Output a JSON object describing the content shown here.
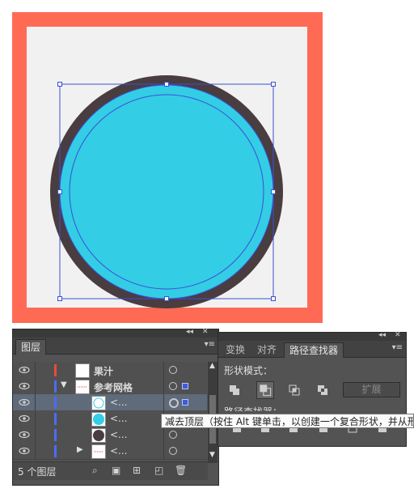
{
  "layers_panel": {
    "collapse_icon": "double-chevron-left-icon",
    "close_icon": "close-icon",
    "tab_label": "图层",
    "menu_icon": "panel-menu-icon",
    "rows": [
      {
        "name": "果汁",
        "color": "#e84c3d"
      },
      {
        "name": "参考网格",
        "color": "#4a6cf7"
      },
      {
        "name": "<...",
        "color": "#4a6cf7"
      },
      {
        "name": "<...",
        "color": "#4a6cf7"
      },
      {
        "name": "<...",
        "color": "#4a6cf7"
      },
      {
        "name": "<...",
        "color": "#4a6cf7"
      }
    ],
    "footer_label": "5 个图层"
  },
  "pathfinder_panel": {
    "tabs": [
      "变换",
      "对齐",
      "路径查找器"
    ],
    "active_tab": "路径查找器",
    "shape_modes_label": "形状模式：",
    "expand_label": "扩展",
    "pathfinders_label": "路径查找器："
  },
  "tooltip": {
    "text": "减去顶层（按住 Alt 键单击，以创建一个复合形状，并从形"
  },
  "colors": {
    "frame": "#ff6a55",
    "artboard": "#f1f1f1",
    "ring": "#493d40",
    "juice": "#33cde5",
    "selection": "#3b4fd8",
    "panel_bg": "#535353"
  }
}
